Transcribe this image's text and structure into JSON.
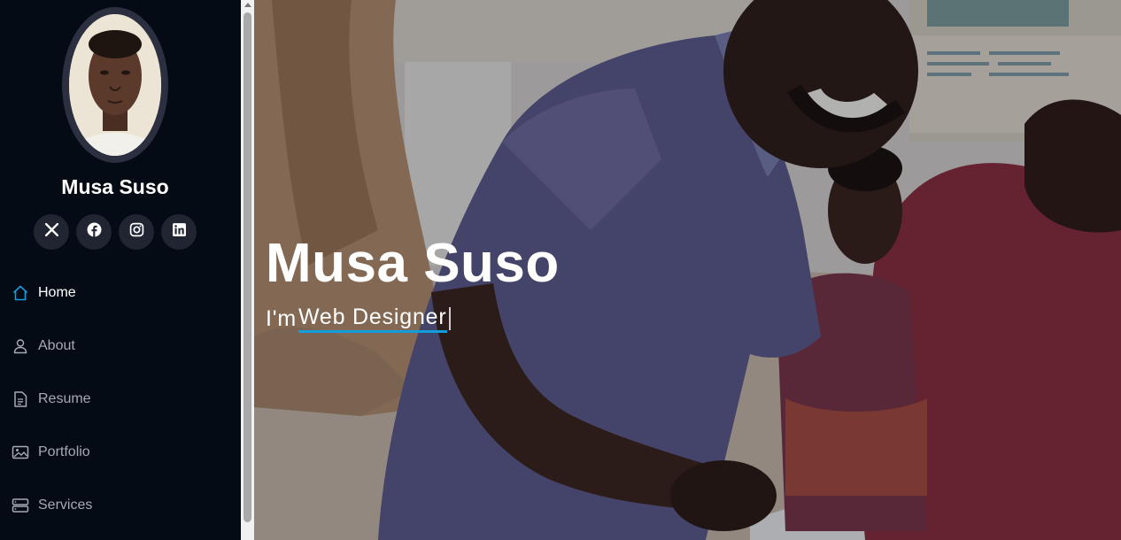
{
  "profile": {
    "name": "Musa Suso"
  },
  "socials": [
    {
      "icon": "x-twitter-icon"
    },
    {
      "icon": "facebook-icon"
    },
    {
      "icon": "instagram-icon"
    },
    {
      "icon": "linkedin-icon"
    }
  ],
  "nav": {
    "items": [
      {
        "label": "Home",
        "icon": "house-icon",
        "active": true
      },
      {
        "label": "About",
        "icon": "person-icon"
      },
      {
        "label": "Resume",
        "icon": "file-text-icon"
      },
      {
        "label": "Portfolio",
        "icon": "images-icon"
      },
      {
        "label": "Services",
        "icon": "server-icon"
      }
    ]
  },
  "hero": {
    "title": "Musa Suso",
    "prefix": "I'm",
    "role": "Web Designer"
  },
  "colors": {
    "sidebar_bg": "#040b14",
    "accent": "#149ddd",
    "social_bg": "#212431"
  }
}
